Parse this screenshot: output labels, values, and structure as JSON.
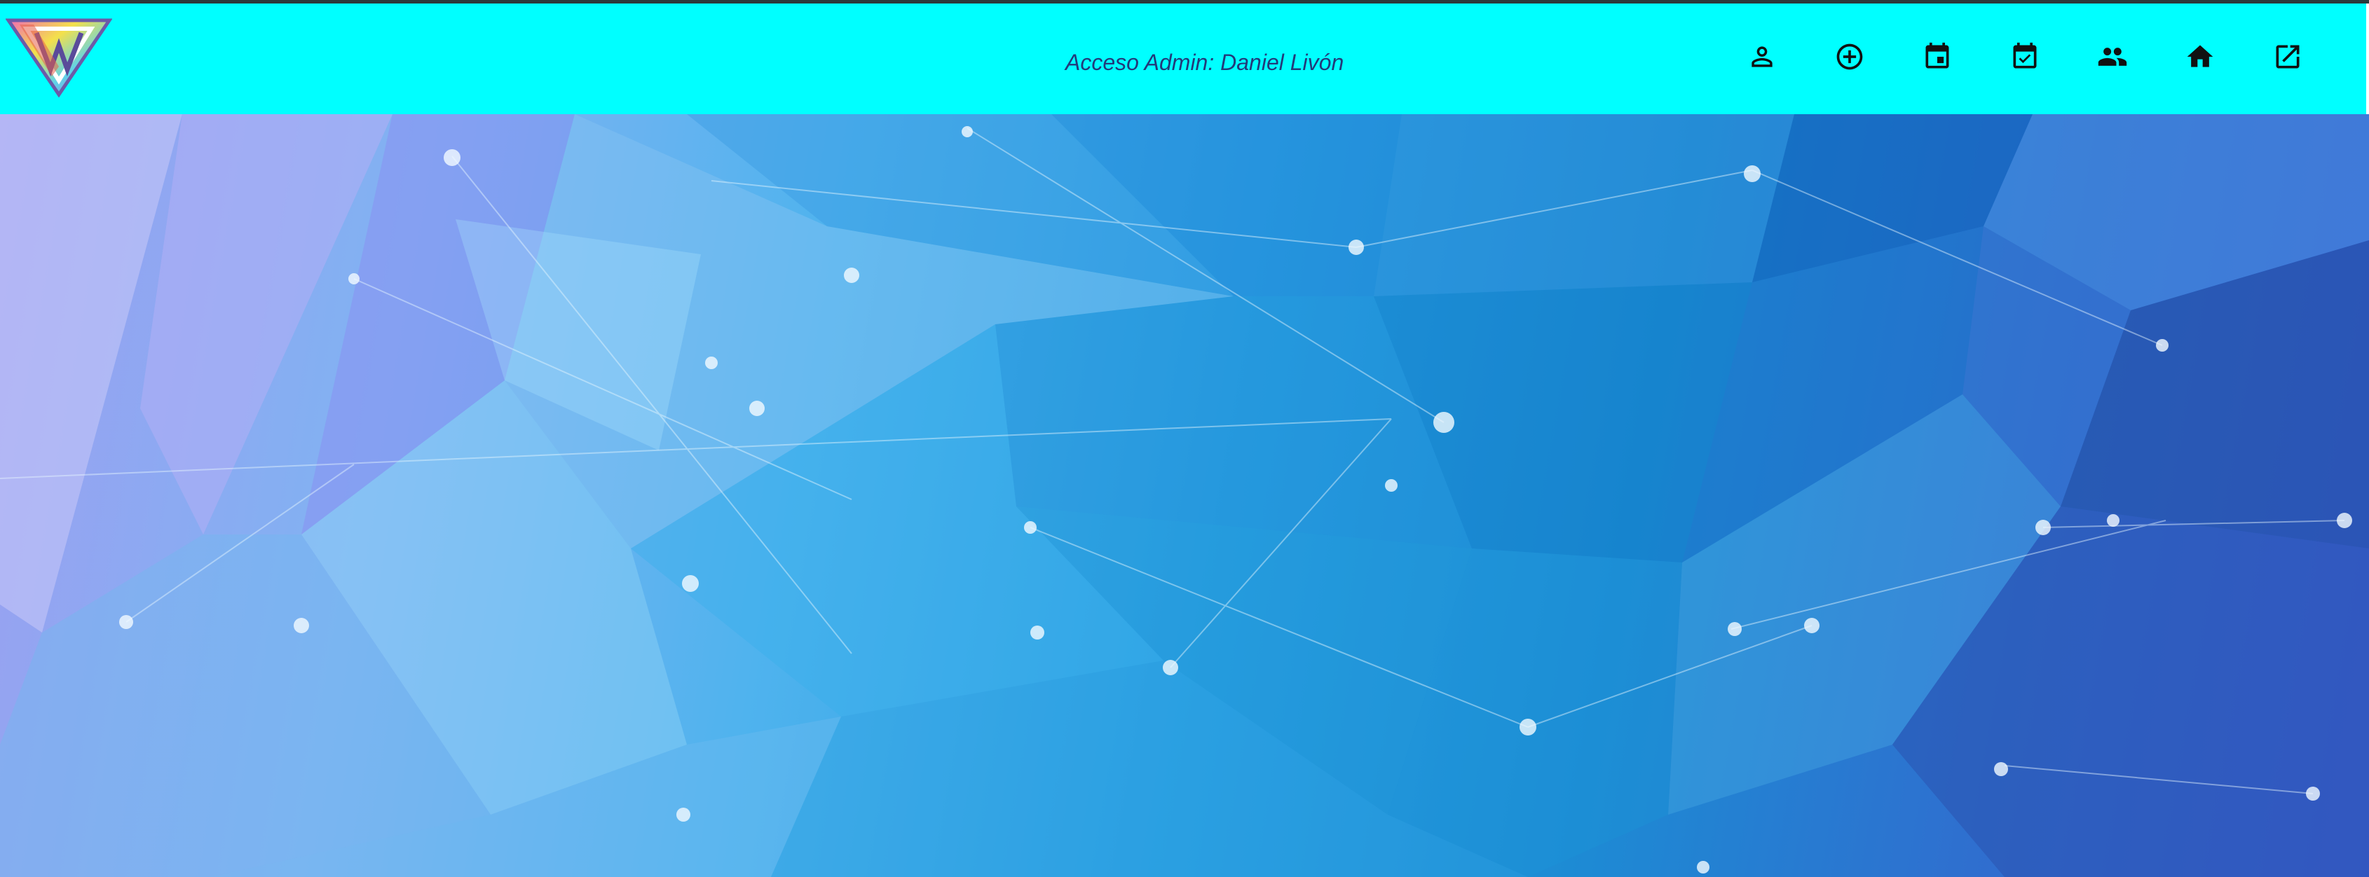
{
  "header": {
    "admin_text": "Acceso Admin: Daniel Livón",
    "background_color": "#00ffff",
    "icons": [
      {
        "name": "person-icon"
      },
      {
        "name": "add-circle-icon"
      },
      {
        "name": "calendar-event-icon"
      },
      {
        "name": "calendar-check-icon"
      },
      {
        "name": "group-icon"
      },
      {
        "name": "home-icon"
      },
      {
        "name": "open-external-icon"
      }
    ]
  },
  "logo": {
    "name": "brand-logo"
  },
  "hero": {
    "name": "polygon-network-background"
  }
}
